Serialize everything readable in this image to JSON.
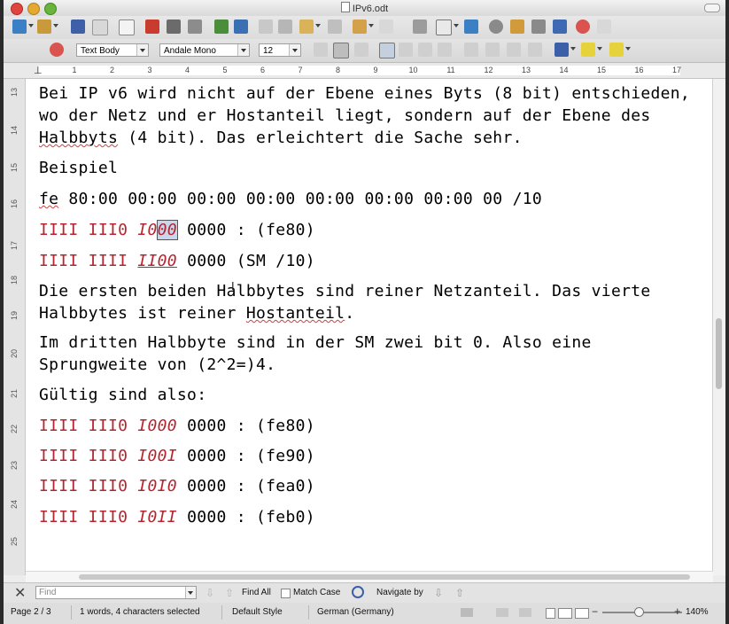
{
  "window": {
    "title": "IPv6.odt"
  },
  "toolbar2": {
    "paragraph_style": "Text Body",
    "font_name": "Andale Mono",
    "font_size": "12"
  },
  "ruler": {
    "marks": [
      "1",
      "2",
      "3",
      "4",
      "5",
      "6",
      "7",
      "8",
      "9",
      "10",
      "11",
      "12",
      "13",
      "14",
      "15",
      "16",
      "17"
    ]
  },
  "vruler": {
    "marks": [
      "13",
      "14",
      "15",
      "16",
      "17",
      "18",
      "19",
      "20",
      "21",
      "22",
      "23",
      "24",
      "25"
    ]
  },
  "document": {
    "l1": "Bei IP v6 wird nicht auf der Ebene eines Byts (8 bit) entschieden,",
    "l2": "wo der Netz und er Hostanteil liegt, sondern auf der Ebene des",
    "l3a": "Halbbyts",
    "l3b": " (4 bit). Das erleichtert die Sache sehr.",
    "l4": "Beispiel",
    "l5a": "fe",
    "l5b": " 80:00 00:00 00:00 00:00 00:00 00:00 00:00 00 /10",
    "l6red": "IIII III0 ",
    "l6i": "I0",
    "l6sel": "00",
    "l6rest": " 0000 : (fe80)",
    "l7red": "IIII IIII ",
    "l7i": "II00",
    "l7rest": " 0000 (SM /10)",
    "l8": "Die ersten beiden Halbbytes sind reiner Netzanteil. Das vierte",
    "l9a": "Halbbytes ist reiner ",
    "l9b": "Hostanteil",
    "l9c": ".",
    "l10": "Im dritten Halbbyte sind in der SM zwei bit 0. Also eine",
    "l11": "Sprungweite von (2^2=)4.",
    "l12": "Gültig sind also:",
    "rows": [
      {
        "red": "IIII III0 ",
        "ital": "I000",
        "rest": " 0000 : (fe80)"
      },
      {
        "red": "IIII III0 ",
        "ital": "I00I",
        "rest": " 0000 : (fe90)"
      },
      {
        "red": "IIII III0 ",
        "ital": "I0I0",
        "rest": " 0000 : (fea0)"
      },
      {
        "red": "IIII III0 ",
        "ital": "I0II",
        "rest": " 0000 : (feb0)"
      }
    ]
  },
  "findbar": {
    "placeholder": "Find",
    "find_all": "Find All",
    "match_case": "Match Case",
    "navigate_by": "Navigate by"
  },
  "statusbar": {
    "page": "Page 2 / 3",
    "selection": "1 words, 4 characters selected",
    "page_style": "Default Style",
    "language": "German (Germany)",
    "zoom": "140%"
  },
  "colors": {
    "accent_red": "#b3262f",
    "selection": "#c9d6ec"
  }
}
